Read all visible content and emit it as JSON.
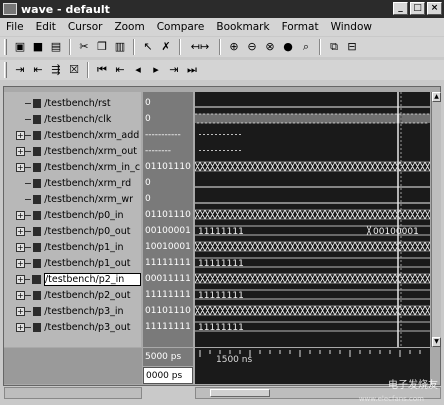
{
  "window": {
    "title": "wave - default"
  },
  "menu": [
    "File",
    "Edit",
    "Cursor",
    "Zoom",
    "Compare",
    "Bookmark",
    "Format",
    "Window"
  ],
  "signals": [
    {
      "name": "/testbench/rst",
      "value": "0",
      "expandable": false,
      "wave": "low"
    },
    {
      "name": "/testbench/clk",
      "value": "0",
      "expandable": false,
      "wave": "clock"
    },
    {
      "name": "/testbench/xrm_add",
      "value": "-----------",
      "expandable": true,
      "wave": "bus-undef"
    },
    {
      "name": "/testbench/xrm_out",
      "value": "--------",
      "expandable": true,
      "wave": "bus-undef"
    },
    {
      "name": "/testbench/xrm_in_c",
      "value": "01101110",
      "expandable": true,
      "wave": "bus-busy"
    },
    {
      "name": "/testbench/xrm_rd",
      "value": "0",
      "expandable": false,
      "wave": "low"
    },
    {
      "name": "/testbench/xrm_wr",
      "value": "0",
      "expandable": false,
      "wave": "low"
    },
    {
      "name": "/testbench/p0_in",
      "value": "01101110",
      "expandable": true,
      "wave": "bus-busy"
    },
    {
      "name": "/testbench/p0_out",
      "value": "00100001",
      "expandable": true,
      "wave": "bus-stable",
      "wave_label": "11111111",
      "late_label": "00100001"
    },
    {
      "name": "/testbench/p1_in",
      "value": "10010001",
      "expandable": true,
      "wave": "bus-busy"
    },
    {
      "name": "/testbench/p1_out",
      "value": "11111111",
      "expandable": true,
      "wave": "bus-stable",
      "wave_label": "11111111"
    },
    {
      "name": "/testbench/p2_in",
      "value": "00011111",
      "expandable": true,
      "wave": "bus-busy",
      "selected": true
    },
    {
      "name": "/testbench/p2_out",
      "value": "11111111",
      "expandable": true,
      "wave": "bus-stable",
      "wave_label": "11111111"
    },
    {
      "name": "/testbench/p3_in",
      "value": "01101110",
      "expandable": true,
      "wave": "bus-busy"
    },
    {
      "name": "/testbench/p3_out",
      "value": "11111111",
      "expandable": true,
      "wave": "bus-stable",
      "wave_label": "11111111"
    }
  ],
  "time": {
    "now": "5000 ps",
    "cursor": "0000 ps",
    "axis_label": "1500 ns"
  },
  "watermark": {
    "main": "电子发烧友",
    "sub": "www.elecfans.com"
  },
  "colors": {
    "wave_bg": "#1a1a1a",
    "wave_line": "#f0f0f0",
    "undef": "#bfbfbf"
  }
}
